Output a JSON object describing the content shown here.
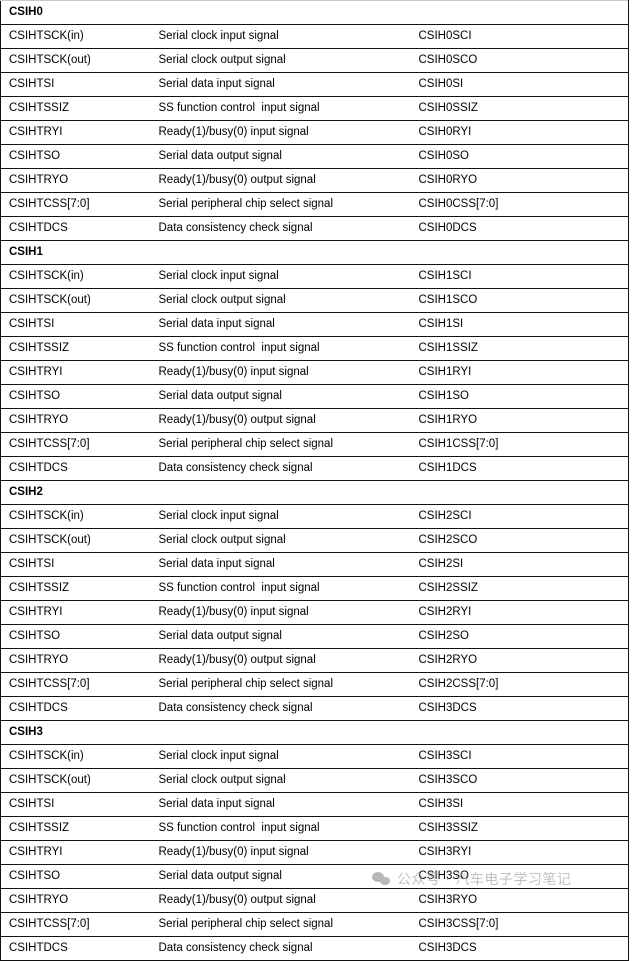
{
  "table": {
    "columns": [
      "signal_name",
      "description",
      "pin_name"
    ],
    "groups": [
      {
        "label": "CSIH0",
        "rows": [
          {
            "signal": "CSIHTSCK(in)",
            "description": "Serial clock input signal",
            "pin": "CSIH0SCI"
          },
          {
            "signal": "CSIHTSCK(out)",
            "description": "Serial clock output signal",
            "pin": "CSIH0SCO"
          },
          {
            "signal": "CSIHTSI",
            "description": "Serial data input signal",
            "pin": "CSIH0SI"
          },
          {
            "signal": "CSIHTSSIZ",
            "description": "SS function control  input signal",
            "pin": "CSIH0SSIZ"
          },
          {
            "signal": "CSIHTRYI",
            "description": "Ready(1)/busy(0) input signal",
            "pin": "CSIH0RYI"
          },
          {
            "signal": "CSIHTSO",
            "description": "Serial data output signal",
            "pin": "CSIH0SO"
          },
          {
            "signal": "CSIHTRYO",
            "description": "Ready(1)/busy(0) output signal",
            "pin": "CSIH0RYO"
          },
          {
            "signal": "CSIHTCSS[7:0]",
            "description": "Serial peripheral chip select signal",
            "pin": "CSIH0CSS[7:0]"
          },
          {
            "signal": "CSIHTDCS",
            "description": "Data consistency check signal",
            "pin": "CSIH0DCS"
          }
        ]
      },
      {
        "label": "CSIH1",
        "rows": [
          {
            "signal": "CSIHTSCK(in)",
            "description": "Serial clock input signal",
            "pin": "CSIH1SCI"
          },
          {
            "signal": "CSIHTSCK(out)",
            "description": "Serial clock output signal",
            "pin": "CSIH1SCO"
          },
          {
            "signal": "CSIHTSI",
            "description": "Serial data input signal",
            "pin": "CSIH1SI"
          },
          {
            "signal": "CSIHTSSIZ",
            "description": "SS function control  input signal",
            "pin": "CSIH1SSIZ"
          },
          {
            "signal": "CSIHTRYI",
            "description": "Ready(1)/busy(0) input signal",
            "pin": "CSIH1RYI"
          },
          {
            "signal": "CSIHTSO",
            "description": "Serial data output signal",
            "pin": "CSIH1SO"
          },
          {
            "signal": "CSIHTRYO",
            "description": "Ready(1)/busy(0) output signal",
            "pin": "CSIH1RYO"
          },
          {
            "signal": "CSIHTCSS[7:0]",
            "description": "Serial peripheral chip select signal",
            "pin": "CSIH1CSS[7:0]"
          },
          {
            "signal": "CSIHTDCS",
            "description": "Data consistency check signal",
            "pin": "CSIH1DCS"
          }
        ]
      },
      {
        "label": "CSIH2",
        "rows": [
          {
            "signal": "CSIHTSCK(in)",
            "description": "Serial clock input signal",
            "pin": "CSIH2SCI"
          },
          {
            "signal": "CSIHTSCK(out)",
            "description": "Serial clock output signal",
            "pin": "CSIH2SCO"
          },
          {
            "signal": "CSIHTSI",
            "description": "Serial data input signal",
            "pin": "CSIH2SI"
          },
          {
            "signal": "CSIHTSSIZ",
            "description": "SS function control  input signal",
            "pin": "CSIH2SSIZ"
          },
          {
            "signal": "CSIHTRYI",
            "description": "Ready(1)/busy(0) input signal",
            "pin": "CSIH2RYI"
          },
          {
            "signal": "CSIHTSO",
            "description": "Serial data output signal",
            "pin": "CSIH2SO"
          },
          {
            "signal": "CSIHTRYO",
            "description": "Ready(1)/busy(0) output signal",
            "pin": "CSIH2RYO"
          },
          {
            "signal": "CSIHTCSS[7:0]",
            "description": "Serial peripheral chip select signal",
            "pin": "CSIH2CSS[7:0]"
          },
          {
            "signal": "CSIHTDCS",
            "description": "Data consistency check signal",
            "pin": "CSIH3DCS"
          }
        ]
      },
      {
        "label": "CSIH3",
        "rows": [
          {
            "signal": "CSIHTSCK(in)",
            "description": "Serial clock input signal",
            "pin": "CSIH3SCI"
          },
          {
            "signal": "CSIHTSCK(out)",
            "description": "Serial clock output signal",
            "pin": "CSIH3SCO"
          },
          {
            "signal": "CSIHTSI",
            "description": "Serial data input signal",
            "pin": "CSIH3SI"
          },
          {
            "signal": "CSIHTSSIZ",
            "description": "SS function control  input signal",
            "pin": "CSIH3SSIZ"
          },
          {
            "signal": "CSIHTRYI",
            "description": "Ready(1)/busy(0) input signal",
            "pin": "CSIH3RYI"
          },
          {
            "signal": "CSIHTSO",
            "description": "Serial data output signal",
            "pin": "CSIH3SO"
          },
          {
            "signal": "CSIHTRYO",
            "description": "Ready(1)/busy(0) output signal",
            "pin": "CSIH3RYO"
          },
          {
            "signal": "CSIHTCSS[7:0]",
            "description": "Serial peripheral chip select signal",
            "pin": "CSIH3CSS[7:0]"
          },
          {
            "signal": "CSIHTDCS",
            "description": "Data consistency check signal",
            "pin": "CSIH3DCS"
          }
        ]
      }
    ]
  },
  "watermark": {
    "icon": "wechat-bubbles-icon",
    "text": "公众号 · 汽车电子学习笔记",
    "color": "#9a9a9a"
  }
}
